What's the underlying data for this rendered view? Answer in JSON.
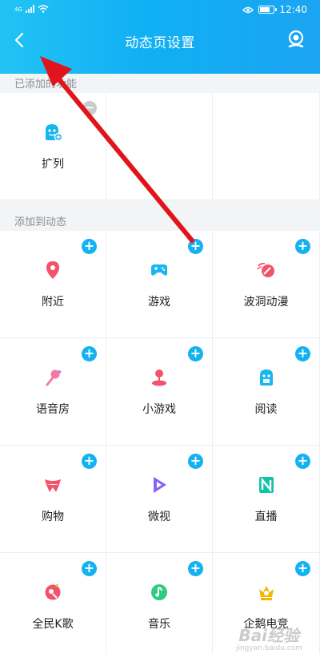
{
  "statusbar": {
    "time": "12:40",
    "network": "4G"
  },
  "header": {
    "title": "动态页设置"
  },
  "sections": {
    "added_label": "已添加的功能",
    "add_label": "添加到动态"
  },
  "added_items": [
    {
      "label": "扩列",
      "icon": "kuolie-icon",
      "color": "#16b6ef"
    }
  ],
  "add_items": [
    {
      "label": "附近",
      "icon": "location-pin-icon",
      "color": "#f2536a"
    },
    {
      "label": "游戏",
      "icon": "gamepad-icon",
      "color": "#1ab6ee"
    },
    {
      "label": "波洞动漫",
      "icon": "bodong-icon",
      "color": "#f2536a"
    },
    {
      "label": "语音房",
      "icon": "microphone-icon",
      "color": "#f47aa6"
    },
    {
      "label": "小游戏",
      "icon": "joystick-icon",
      "color": "#f2536a"
    },
    {
      "label": "阅读",
      "icon": "reading-icon",
      "color": "#1ab6ee"
    },
    {
      "label": "购物",
      "icon": "shopping-bow-icon",
      "color": "#f2536a"
    },
    {
      "label": "微视",
      "icon": "weishi-icon",
      "color": "#8a63f0"
    },
    {
      "label": "直播",
      "icon": "live-n-icon",
      "color": "#12c3a6"
    },
    {
      "label": "全民K歌",
      "icon": "karaoke-icon",
      "color": "#f2536a"
    },
    {
      "label": "音乐",
      "icon": "music-note-icon",
      "color": "#2dcc7e"
    },
    {
      "label": "企鹅电竞",
      "icon": "esports-crown-icon",
      "color": "#f5b400"
    }
  ],
  "watermark": {
    "text": "Bai经验",
    "sub": "jingyan.baidu.com"
  }
}
